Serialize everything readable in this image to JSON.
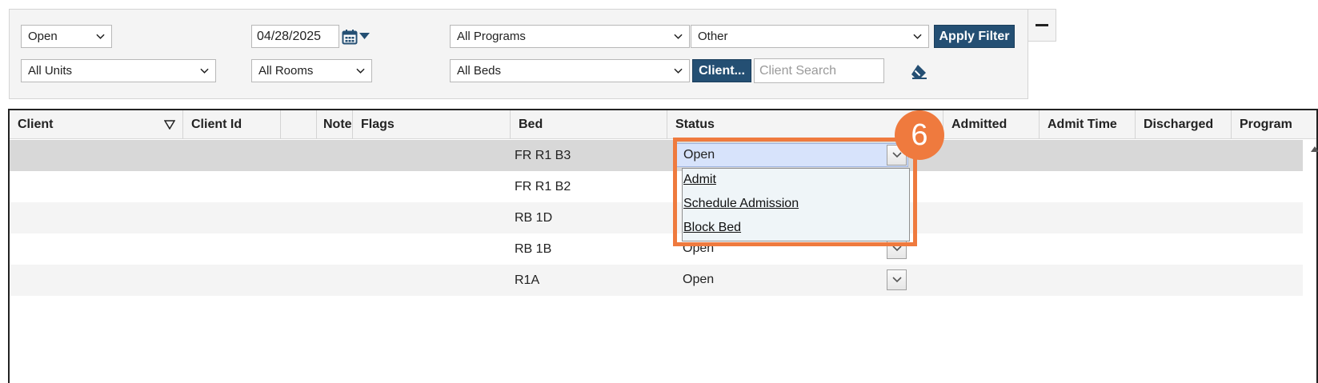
{
  "filters": {
    "status_select": "Open",
    "date_value": "04/28/2025",
    "programs_select": "All Programs",
    "other_select": "Other",
    "apply_label": "Apply Filter",
    "units_select": "All Units",
    "rooms_select": "All Rooms",
    "beds_select": "All Beds",
    "client_button_label": "Client...",
    "client_search_placeholder": "Client Search"
  },
  "grid": {
    "columns": [
      "Client",
      "Client Id",
      "",
      "Note",
      "Flags",
      "Bed",
      "Status",
      "Admitted",
      "Admit Time",
      "Discharged",
      "Program"
    ],
    "rows": [
      {
        "bed": "FR R1 B3",
        "status": "Open"
      },
      {
        "bed": "FR R1 B2",
        "status": ""
      },
      {
        "bed": "RB 1D",
        "status": ""
      },
      {
        "bed": "RB 1B",
        "status": "Open"
      },
      {
        "bed": "R1A",
        "status": "Open"
      }
    ]
  },
  "status_dropdown": {
    "options": [
      "Admit",
      "Schedule Admission",
      "Block Bed"
    ]
  },
  "annotation": {
    "step_number": "6",
    "color": "#ef7a3e"
  },
  "colors": {
    "button_dark": "#244f73",
    "selected_row": "#d8d8d8",
    "active_status": "#d7e3fb"
  }
}
